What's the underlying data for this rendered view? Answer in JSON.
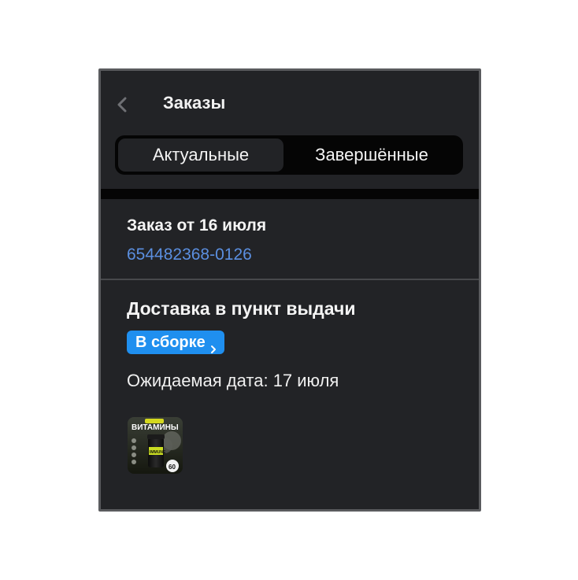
{
  "header": {
    "title": "Заказы",
    "back_icon": "chevron-left-icon"
  },
  "tabs": [
    {
      "label": "Актуальные",
      "active": true
    },
    {
      "label": "Завершённые",
      "active": false
    }
  ],
  "order": {
    "title": "Заказ от 16 июля",
    "number": "654482368-0126",
    "number_color": "#5b8fe0"
  },
  "delivery": {
    "title": "Доставка в пункт выдачи",
    "status": "В сборке",
    "status_color": "#1f8fef",
    "expected_date": "Ожидаемая дата: 17 июля"
  },
  "product": {
    "thumbnail_text": "ВИТАМИНЫ",
    "thumbnail_badge": "60",
    "thumbnail_label": "IMMUNE"
  }
}
